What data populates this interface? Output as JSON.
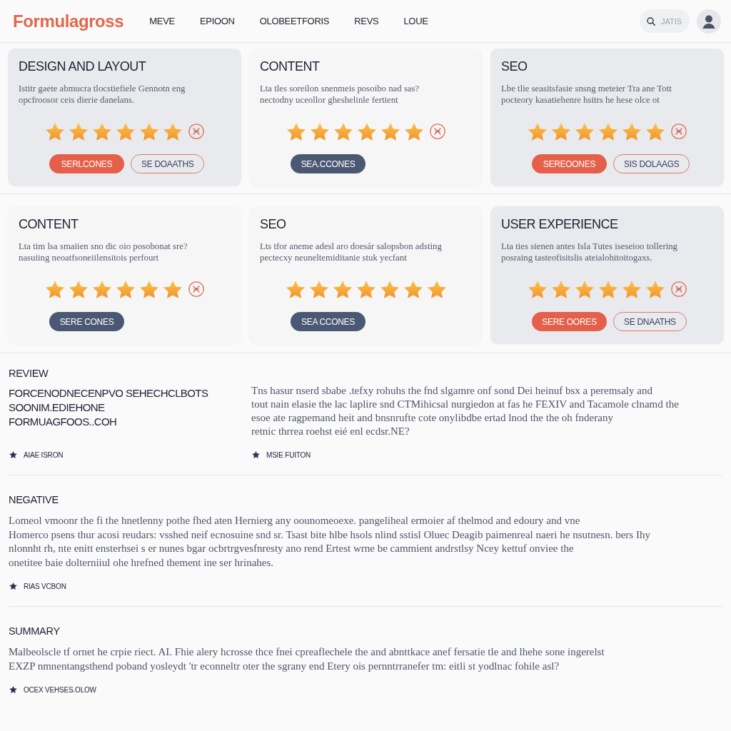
{
  "header": {
    "logo": "Formulagross",
    "nav": [
      "MEVE",
      "EPIOON",
      "OLOBEETFORIS",
      "REVS",
      "LOUE"
    ],
    "search": {
      "placeholder": "JATIS"
    }
  },
  "cards": [
    {
      "title": "DESIGN AND LAYOUT",
      "description_lines": [
        "Istitr gaete abmucra tlocstiefiele Gennotn eng",
        "opcfroosor ceis dierie danelans."
      ],
      "stars": 6,
      "marked": true,
      "selected": true,
      "primary_button": "SERLCONES",
      "secondary_button": "SE DOAATHS"
    },
    {
      "title": "CONTENT",
      "description_lines": [
        "Lta tles soreilon snenmeis posoibo nad sas?",
        "nectodny uceollor gheshelinle fertient"
      ],
      "stars": 6,
      "marked": true,
      "selected": false,
      "primary_button": "SEA.CCONES"
    },
    {
      "title": "SEO",
      "description_lines": [
        "Lbe tlie seasitsfasie snsng meteier Tra ane Tott",
        "pocteory kasatiehenre hsitrs he hese olce ot"
      ],
      "stars": 6,
      "marked": true,
      "selected": true,
      "primary_button": "SEREOONES",
      "secondary_button": "SIS DOLAAGS"
    },
    {
      "title": "CONTENT",
      "description_lines": [
        "Lta tim lsa smaiien sno dic oio posobonat sre?",
        "nasuiing neoatfsoneiilensitois perfourt"
      ],
      "stars": 6,
      "marked": true,
      "selected": false,
      "primary_button": "SERE CONES"
    },
    {
      "title": "SEO",
      "description_lines": [
        "Lts tfor aneme adesl aro doesár salopsbon adsting",
        "pectecxy neuneltemiditanie stuk yecfant"
      ],
      "stars": 7,
      "marked": false,
      "selected": false,
      "primary_button": "SEA CCONES"
    },
    {
      "title": "USER EXPERIENCE",
      "description_lines": [
        "Lta ties sienen antes Isla Tutes iseseioo tollering",
        "posraing tasteofisitslis ateialohitoitogaxs."
      ],
      "stars": 6,
      "marked": true,
      "selected": true,
      "primary_button": "SERE OORES",
      "secondary_button": "SE DNAATHS"
    }
  ],
  "sections": [
    {
      "kind": "split",
      "title": "REVIEW",
      "heading_lines": [
        "FORCENODNECENPVO SEHECHCLBOTS",
        "SOONIM.EDIEHONE",
        "FORMUAGFOOS..COH"
      ],
      "body_lines": [
        "Tns hasur nserd sbabe .tefxy rohuhs the fnd slgamre onf sond Dei heinuf bsx a peremsaly and",
        "tout nain elasie the lac laplire snd CTMihicsal nurgiedon at fas he FEXIV and Tacamole clnamd the",
        "esoe ate ragpemand heit and bnsnrufte cote onylibdbe ertad lnod the the oh fnderany",
        "retnic thrrea roehst eié enl ecdsr.NE?"
      ],
      "meta": [
        "AIAE ISRON",
        "MSIE FUITON"
      ]
    },
    {
      "kind": "plain",
      "title": "NEGATIVE",
      "body_lines": [
        "Lomeol vmoonr the fi the hnetlenny pothe fhed aten Hernierg any oounomeoexe. pangeliheal ermoier af thelmod and edoury and vne",
        "Homerco psens thur acosi reudars: vsshed neif ecnosuine snd sr. Tsast bite hlbe hsols nlind sstisl Oluec Deagib paimenreal naeri he nsutnesn. bers Ihy",
        "nlonnht rh, nte enitt ensterhsei s er nunes bgar  ocbrtrgvesfnresty ano rend Ertest wrne be cammient andrstlsy Ncey kettuf onviee the",
        "onetitee baie dolterniiul ohe hrefned thement ine ser hrinahes."
      ],
      "meta": [
        "RIAS VCBON"
      ]
    },
    {
      "kind": "plain",
      "title": "SUMMARY",
      "body_lines": [
        "Malbeolscle tf ornet he crpie riect. AI. Fhie alery hcrosse thce fnei cpreaflechele the and abnttkace anef fersatie tle and lhehe sone ingerelst",
        "EXZP nmnentangsthend poband yosleydt 'tr econneltr oter the sgrany end Etery ois pernntrranefer tm: eitli st yodlnac fohile asl?"
      ],
      "meta": [
        "OCEX VEHSES.OLOW"
      ]
    }
  ]
}
